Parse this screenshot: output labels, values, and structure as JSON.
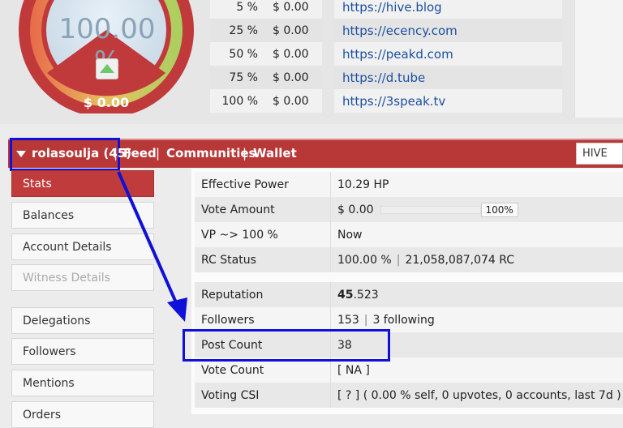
{
  "gauge": {
    "percent_text": "100.00 %",
    "value": "$ 0.00"
  },
  "vote_values": [
    {
      "pct": "5 %",
      "amount": "$ 0.00"
    },
    {
      "pct": "25 %",
      "amount": "$ 0.00"
    },
    {
      "pct": "50 %",
      "amount": "$ 0.00"
    },
    {
      "pct": "75 %",
      "amount": "$ 0.00"
    },
    {
      "pct": "100 %",
      "amount": "$ 0.00"
    }
  ],
  "links": [
    "https://hive.blog",
    "https://ecency.com",
    "https://peakd.com",
    "https://d.tube",
    "https://3speak.tv"
  ],
  "nav": {
    "account": "rolasoulja (45)",
    "items": [
      "Feed",
      "Communities",
      "Wallet"
    ],
    "separator": "|",
    "chain": "HIVE"
  },
  "sidebar": {
    "items": [
      {
        "label": "Stats"
      },
      {
        "label": "Balances"
      },
      {
        "label": "Account Details"
      },
      {
        "label": "Witness Details"
      },
      {
        "label": "Delegations"
      },
      {
        "label": "Followers"
      },
      {
        "label": "Mentions"
      },
      {
        "label": "Orders"
      }
    ]
  },
  "stats": {
    "effective_power": {
      "label": "Effective Power",
      "value": "10.29 HP"
    },
    "vote_amount": {
      "label": "Vote Amount",
      "value": "$ 0.00",
      "slider_pct": "100%"
    },
    "vp": {
      "label": "VP ~> 100 %",
      "value": "Now"
    },
    "rc_status": {
      "label": "RC Status",
      "pct": "100.00 %",
      "rc": "21,058,087,074 RC"
    },
    "reputation": {
      "label": "Reputation",
      "value_bold": "45",
      "value_rest": ".523"
    },
    "followers": {
      "label": "Followers",
      "count": "153",
      "following": "3 following"
    },
    "post_count": {
      "label": "Post Count",
      "value": "38"
    },
    "vote_count": {
      "label": "Vote Count",
      "value": "[ NA ]"
    },
    "voting_csi": {
      "label": "Voting CSI",
      "value": "[ ? ] ( 0.00 % self, 0 upvotes, 0 accounts, last 7d )"
    }
  },
  "colors": {
    "accent_red": "#b83838",
    "annotation_blue": "#1010d8",
    "link_blue": "#1c4fa0"
  }
}
